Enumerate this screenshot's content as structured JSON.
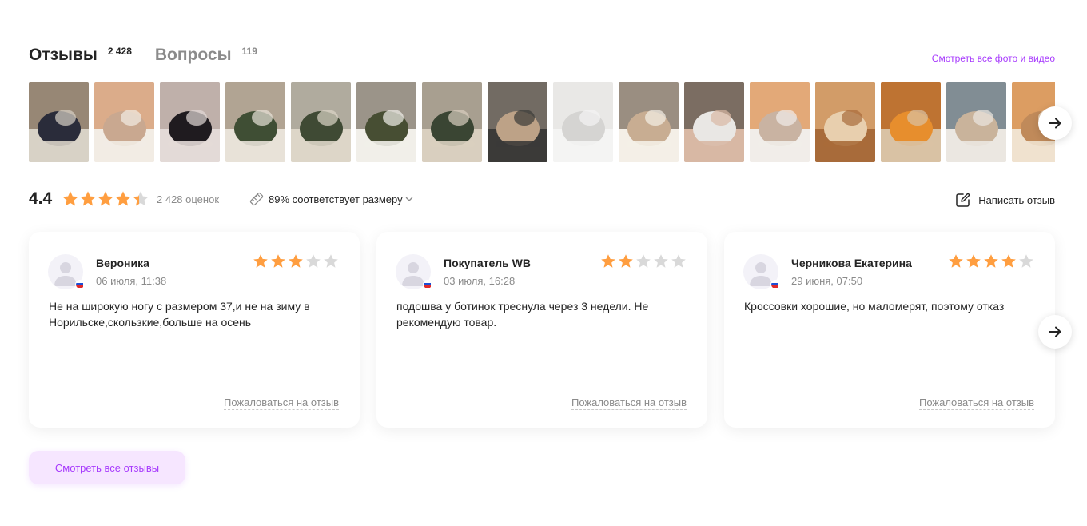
{
  "tabs": [
    {
      "label": "Отзывы",
      "count": "2 428"
    },
    {
      "label": "Вопросы",
      "count": "119"
    }
  ],
  "all_media_link": "Смотреть все фото и видео",
  "photos": [
    {
      "colors": [
        "#8c7a66",
        "#2a2c3a",
        "#d8d2c6"
      ]
    },
    {
      "colors": [
        "#d7a17a",
        "#c9a890",
        "#f2ece4"
      ]
    },
    {
      "colors": [
        "#b8a8a2",
        "#1f1b1f",
        "#e3dad7"
      ]
    },
    {
      "colors": [
        "#a79987",
        "#3f4e34",
        "#e8e2d8"
      ]
    },
    {
      "colors": [
        "#a8a396",
        "#3f4a34",
        "#ddd6c8"
      ]
    },
    {
      "colors": [
        "#8c8478",
        "#474e33",
        "#f1efe9"
      ]
    },
    {
      "colors": [
        "#9f9687",
        "#3a4533",
        "#d9cfbf"
      ]
    },
    {
      "colors": [
        "#7d746b",
        "#bda287",
        "#3b3a38"
      ]
    },
    {
      "colors": [
        "#e6e5e3",
        "#d5d4d2",
        "#f4f4f3"
      ]
    },
    {
      "colors": [
        "#8a7d6f",
        "#c8ad92",
        "#f4efe7"
      ]
    },
    {
      "colors": [
        "#6b5f57",
        "#e9e7e4",
        "#d8b8a4"
      ]
    },
    {
      "colors": [
        "#e09c64",
        "#c9b3a2",
        "#f1ede9"
      ]
    },
    {
      "colors": [
        "#d9a471",
        "#e8cfae",
        "#a86b3a"
      ]
    },
    {
      "colors": [
        "#b8651e",
        "#e78e2d",
        "#d9c2a4"
      ]
    },
    {
      "colors": [
        "#6f7c86",
        "#c9b39b",
        "#ebe7e1"
      ]
    },
    {
      "colors": [
        "#d8914f",
        "#c08a5a",
        "#f0e2cf"
      ]
    }
  ],
  "summary": {
    "rating": "4.4",
    "rating_value": 4.4,
    "ratings_count": "2 428 оценок",
    "size_fit": "89% соответствует размеру",
    "write_review": "Написать отзыв"
  },
  "reviews": [
    {
      "name": "Вероника",
      "date": "06 июля, 11:38",
      "stars": 3,
      "text": "Не на широкую ногу с размером 37,и не на зиму в Норильске,скользкие,больше на осень",
      "complain": "Пожаловаться на отзыв"
    },
    {
      "name": "Покупатель WB",
      "date": "03 июля, 16:28",
      "stars": 2,
      "text": "подошва у ботинок треснула через 3 недели. Не рекомендую товар.",
      "complain": "Пожаловаться на отзыв"
    },
    {
      "name": "Черникова Екатерина",
      "date": "29 июня, 07:50",
      "stars": 4,
      "text": "Кроссовки хорошие, но маломерят, поэтому отказ",
      "complain": "Пожаловаться на отзыв"
    }
  ],
  "all_reviews_button": "Смотреть все отзывы",
  "colors": {
    "accent": "#a73afd",
    "star_filled": "#ff9e40",
    "star_empty": "#d9d9d9",
    "muted_text": "#8b8b8b"
  }
}
